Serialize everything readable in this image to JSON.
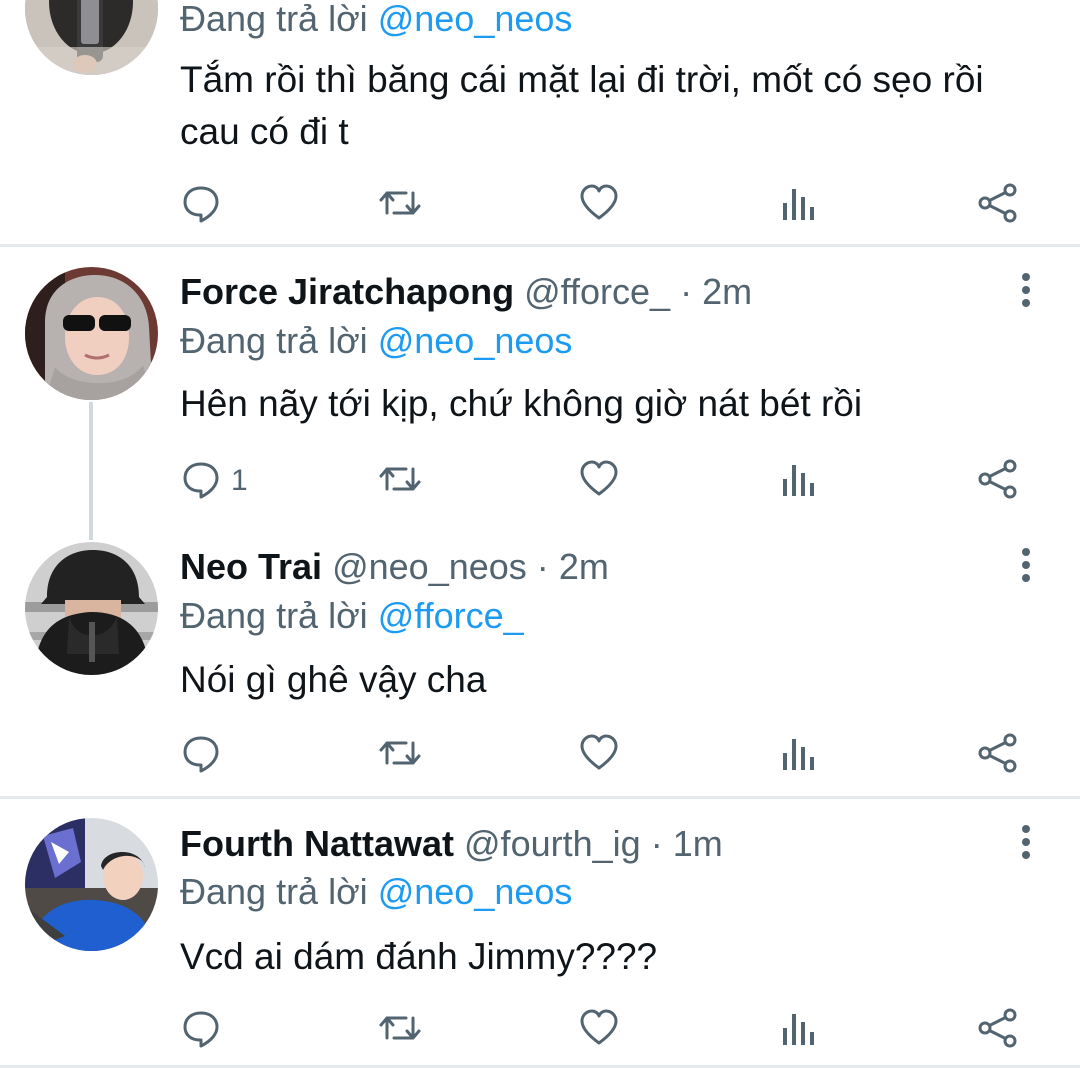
{
  "colors": {
    "text": "#0f1419",
    "secondary": "#536471",
    "accent": "#1d9bf0",
    "divider": "#e6e9ec",
    "thread_line": "#cfd9de"
  },
  "tweets": [
    {
      "reply_prefix": "Đang trả lời",
      "reply_to": "@neo_neos",
      "text": "Tắm rồi thì băng cái mặt lại đi trời, mốt có sẹo rồi cau có đi t",
      "actions": [
        {
          "icon": "reply-icon"
        },
        {
          "icon": "retweet-icon"
        },
        {
          "icon": "like-icon"
        },
        {
          "icon": "views-icon"
        },
        {
          "icon": "share-icon"
        }
      ]
    },
    {
      "name": "Force Jiratchapong",
      "handle": "@fforce_",
      "dot": "·",
      "time": "2m",
      "reply_prefix": "Đang trả lời",
      "reply_to": "@neo_neos",
      "text": "Hên nãy tới kịp, chứ không giờ nát bét rồi",
      "reply_count": "1",
      "actions": [
        {
          "icon": "reply-icon"
        },
        {
          "icon": "retweet-icon"
        },
        {
          "icon": "like-icon"
        },
        {
          "icon": "views-icon"
        },
        {
          "icon": "share-icon"
        }
      ]
    },
    {
      "name": "Neo Trai",
      "handle": "@neo_neos",
      "dot": "·",
      "time": "2m",
      "reply_prefix": "Đang trả lời",
      "reply_to": "@fforce_",
      "text": "Nói gì ghê vậy cha",
      "actions": [
        {
          "icon": "reply-icon"
        },
        {
          "icon": "retweet-icon"
        },
        {
          "icon": "like-icon"
        },
        {
          "icon": "views-icon"
        },
        {
          "icon": "share-icon"
        }
      ]
    },
    {
      "name": "Fourth Nattawat",
      "handle": "@fourth_ig",
      "dot": "·",
      "time": "1m",
      "reply_prefix": "Đang trả lời",
      "reply_to": "@neo_neos",
      "text": "Vcd ai dám đánh Jimmy????",
      "actions": [
        {
          "icon": "reply-icon"
        },
        {
          "icon": "retweet-icon"
        },
        {
          "icon": "like-icon"
        },
        {
          "icon": "views-icon"
        },
        {
          "icon": "share-icon"
        }
      ]
    }
  ]
}
